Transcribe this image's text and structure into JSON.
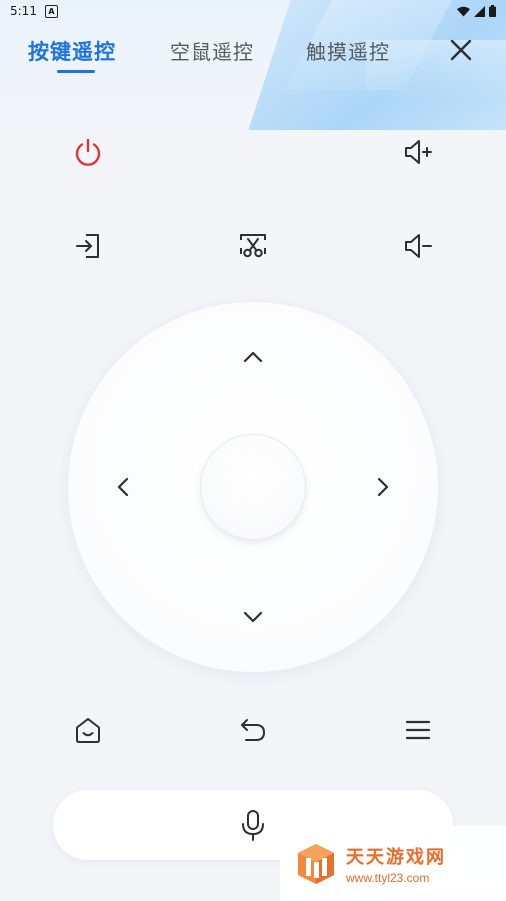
{
  "status_bar": {
    "time": "5:11",
    "notification_icon": "a-box-icon",
    "wifi_icon": "wifi-icon",
    "signal_icon": "signal-icon",
    "battery_icon": "battery-icon"
  },
  "tabs": [
    {
      "label": "按键遥控",
      "active": true
    },
    {
      "label": "空鼠遥控",
      "active": false
    },
    {
      "label": "触摸遥控",
      "active": false
    }
  ],
  "colors": {
    "accent": "#1f73e0",
    "power": "#e0343a",
    "icon": "#2b2f36",
    "background": "#f3f5f9",
    "watermark": "#e86d2b"
  },
  "keys": {
    "power": "power-icon",
    "volume_up": "volume-up-icon",
    "input_source": "input-source-icon",
    "screenshot": "screenshot-icon",
    "volume_down": "volume-down-icon",
    "home": "home-icon",
    "back": "back-icon",
    "menu": "menu-icon",
    "voice": "microphone-icon"
  },
  "dpad": {
    "up": "chevron-up-icon",
    "down": "chevron-down-icon",
    "left": "chevron-left-icon",
    "right": "chevron-right-icon",
    "ok": "ok-button"
  },
  "watermark": {
    "title": "天天游戏网",
    "url": "www.ttyl23.com"
  }
}
